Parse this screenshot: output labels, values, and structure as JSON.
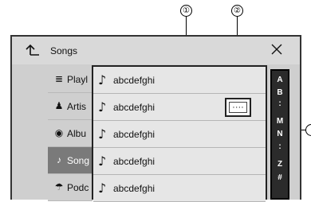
{
  "callouts": {
    "one": "①",
    "two": "②"
  },
  "header": {
    "title": "Songs",
    "back_icon": "back-arrow-icon",
    "close_icon": "close-icon"
  },
  "sidebar": {
    "items": [
      {
        "icon": "playlist-icon",
        "glyph": "≣",
        "label": "Playl",
        "active": false
      },
      {
        "icon": "artist-icon",
        "glyph": "♟",
        "label": "Artis",
        "active": false
      },
      {
        "icon": "album-icon",
        "glyph": "◉",
        "label": "Albu",
        "active": false
      },
      {
        "icon": "song-icon",
        "glyph": "♪",
        "label": "Song",
        "active": true
      },
      {
        "icon": "podcast-icon",
        "glyph": "☂",
        "label": "Podc",
        "active": false
      }
    ]
  },
  "list": {
    "rows": [
      {
        "icon": "music-note-icon",
        "label": "abcdefghi"
      },
      {
        "icon": "music-note-icon",
        "label": "abcdefghi"
      },
      {
        "icon": "music-note-icon",
        "label": "abcdefghi"
      },
      {
        "icon": "music-note-icon",
        "label": "abcdefghi"
      },
      {
        "icon": "music-note-icon",
        "label": "abcdefghi"
      }
    ],
    "more_button": "····"
  },
  "alphabet_index": [
    "A",
    "B",
    ":",
    "M",
    "N",
    ":",
    "Z",
    "#"
  ],
  "colors": {
    "active_item": "#7a7a7a",
    "index_bar": "#2b2b2b"
  }
}
